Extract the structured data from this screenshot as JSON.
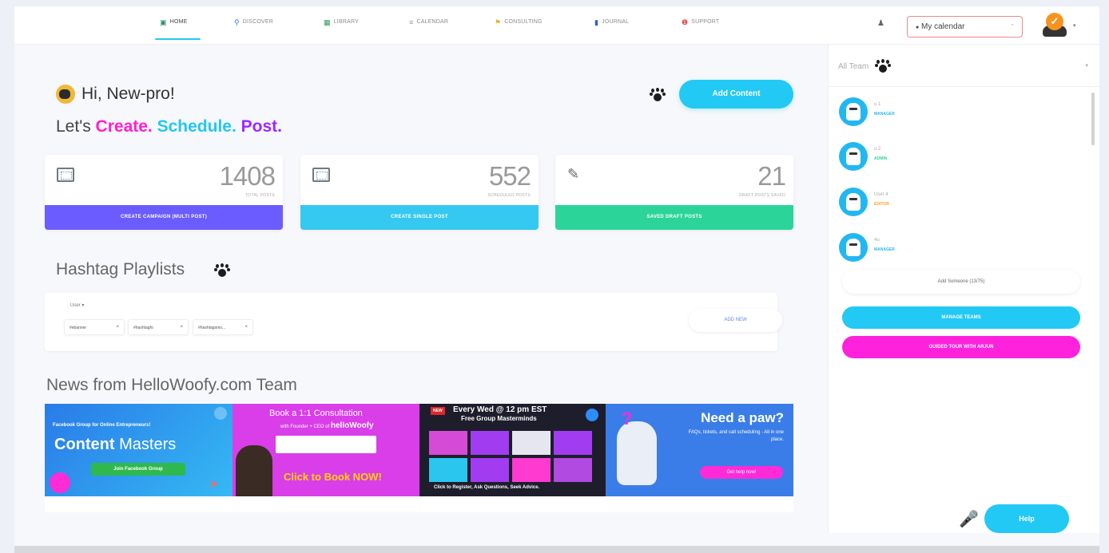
{
  "nav": {
    "items": [
      {
        "label": "HOME",
        "icon": "home-icon"
      },
      {
        "label": "DISCOVER",
        "icon": "search-icon"
      },
      {
        "label": "LIBRARY",
        "icon": "library-icon"
      },
      {
        "label": "CALENDAR",
        "icon": "calendar-icon"
      },
      {
        "label": "CONSULTING",
        "icon": "consulting-icon"
      },
      {
        "label": "JOURNAL",
        "icon": "journal-icon"
      },
      {
        "label": "SUPPORT",
        "icon": "support-icon"
      }
    ],
    "calendar_select": "My calendar",
    "accent": "#23c9f0"
  },
  "greeting": {
    "hello": "Hi, New-pro!",
    "lets": "Let's",
    "create": "Create.",
    "schedule": "Schedule.",
    "post": "Post."
  },
  "add_content_label": "Add Content",
  "stats": [
    {
      "value": "1408",
      "label": "TOTAL POSTS",
      "action": "CREATE CAMPAIGN (MULTI POST)",
      "color": "#6b5cff"
    },
    {
      "value": "552",
      "label": "SCHEDULED POSTS",
      "action": "CREATE SINGLE POST",
      "color": "#35c8f1"
    },
    {
      "value": "21",
      "label": "DRAFT POSTS SAVED",
      "action": "SAVED DRAFT POSTS",
      "color": "#2bd59a"
    }
  ],
  "hashtag": {
    "title": "Hashtag Playlists",
    "user_filter": "User",
    "chips": [
      "#ebanner",
      "#hashtagfo",
      "#hashtagsmo..."
    ],
    "add_new": "ADD NEW"
  },
  "news": {
    "title": "News from HelloWoofy.com Team",
    "banners": {
      "b1_top": "Facebook Group for Online Entrepreneurs!",
      "b1_title1": "Content",
      "b1_title2": "Masters",
      "b1_cta": "Join Facebook Group",
      "b2_title": "Book a 1:1 Consultation",
      "b2_sub": "with Founder + CEO of",
      "b2_brand": "helloWoofy",
      "b2_cta": "Click to Book NOW!",
      "b3_badge": "NEW",
      "b3_title": "Every Wed @ 12 pm EST",
      "b3_sub": "Free Group Masterminds",
      "b3_foot": "Click to Register, Ask Questions, Seek Advice.",
      "b4_title": "Need a paw?",
      "b4_sub": "FAQs, tickets, and call scheduling - All in one place.",
      "b4_cta": "Get help now!"
    }
  },
  "sidebar": {
    "team_select": "All Team",
    "members": [
      {
        "name": "u 1",
        "role": "MANAGER",
        "role_color": "#2fb6ee"
      },
      {
        "name": "u 2",
        "role": "ADMIN",
        "role_color": "#35d49a"
      },
      {
        "name": "User 4",
        "role": "EDITOR",
        "role_color": "#ff9f2e"
      },
      {
        "name": "4u",
        "role": "MANAGER",
        "role_color": "#2fb6ee"
      }
    ],
    "add_someone": "Add Someone (13/75)",
    "manage_teams": "MANAGE TEAMS",
    "guided_tour": "GUIDED TOUR WITH ARJUN"
  },
  "help_label": "Help"
}
